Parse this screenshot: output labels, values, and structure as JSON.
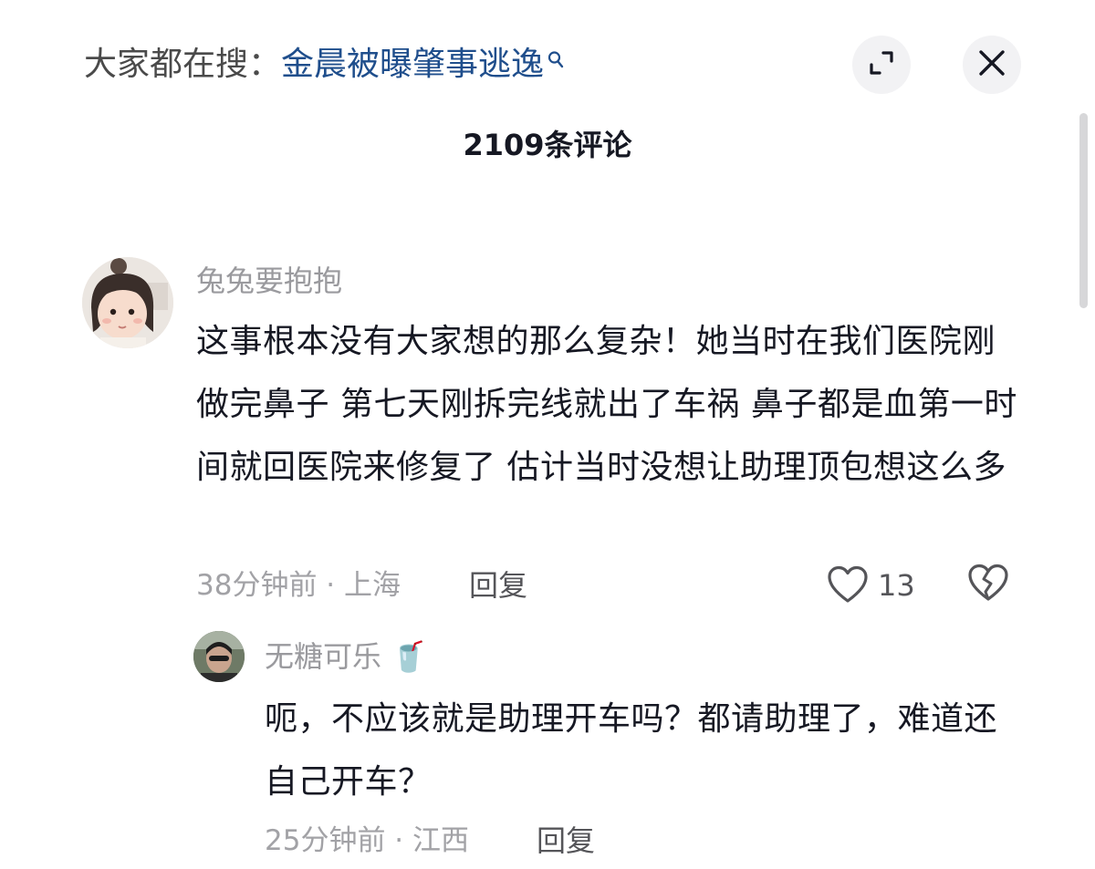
{
  "header": {
    "search_prefix": "大家都在搜：",
    "search_keyword": "金晨被曝肇事逃逸",
    "expand_icon": "expand-icon",
    "close_icon": "close-icon"
  },
  "comments_title": "2109条评论",
  "comments": [
    {
      "username": "兔兔要抱抱",
      "text": "这事根本没有大家想的那么复杂！她当时在我们医院刚做完鼻子 第七天刚拆完线就出了车祸 鼻子都是血第一时间就回医院来修复了 估计当时没想让助理顶包想这么多",
      "meta": "38分钟前 · 上海",
      "reply_label": "回复",
      "like_count": "13"
    },
    {
      "username": "无糖可乐",
      "username_emoji": "🥤",
      "text": "呃，不应该就是助理开车吗？都请助理了，难道还自己开车？",
      "meta": "25分钟前 · 江西",
      "reply_label": "回复"
    }
  ]
}
